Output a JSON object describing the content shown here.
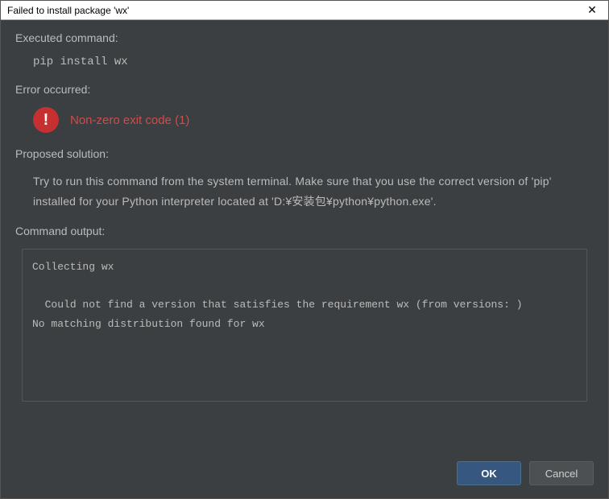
{
  "titlebar": {
    "title": "Failed to install package 'wx'"
  },
  "sections": {
    "executed_label": "Executed command:",
    "command": "pip install wx",
    "error_label": "Error occurred:",
    "error_message": "Non-zero exit code (1)",
    "solution_label": "Proposed solution:",
    "solution_text": "Try to run this command from the system terminal. Make sure that you use the correct version of 'pip' installed for your Python interpreter located at 'D:¥安装包¥python¥python.exe'.",
    "output_label": "Command output:",
    "output_text": "Collecting wx\n\n  Could not find a version that satisfies the requirement wx (from versions: )\nNo matching distribution found for wx"
  },
  "buttons": {
    "ok": "OK",
    "cancel": "Cancel"
  }
}
